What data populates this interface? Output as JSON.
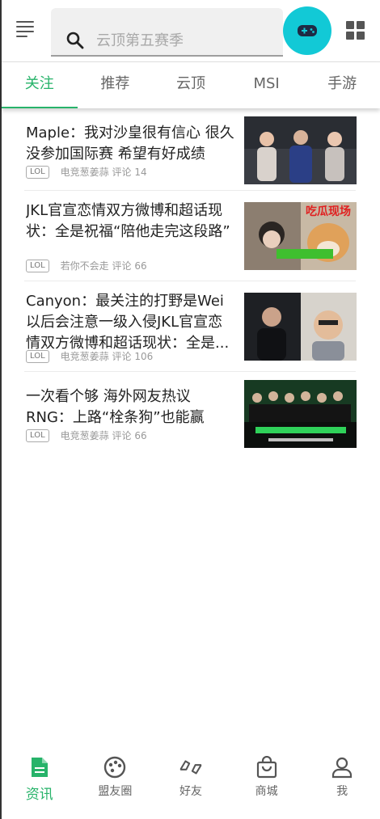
{
  "header": {
    "search_placeholder": "云顶第五赛季"
  },
  "tabs": [
    {
      "label": "关注",
      "active": true
    },
    {
      "label": "推荐"
    },
    {
      "label": "云顶"
    },
    {
      "label": "MSI"
    },
    {
      "label": "手游"
    }
  ],
  "news": [
    {
      "title": "Maple：我对沙皇很有信心 很久没参加国际赛 希望有好成绩",
      "tag": "LOL",
      "source": "电竞葱姜蒜",
      "comments": "评论 14"
    },
    {
      "title": "JKL官宣恋情双方微博和超话现状：全是祝福“陪他走完这段路”",
      "tag": "LOL",
      "source": "若你不会走",
      "comments": "评论 66",
      "thumb_text": "吃瓜现场"
    },
    {
      "title": "Canyon：最关注的打野是Wei 以后会注意一级入侵JKL官宣恋情双方微博和超话现状：全是...",
      "tag": "LOL",
      "source": "电竞葱姜蒜",
      "comments": "评论 106"
    },
    {
      "title": "一次看个够 海外网友热议RNG：上路“栓条狗”也能赢",
      "tag": "LOL",
      "source": "电竞葱姜蒜",
      "comments": "评论 66"
    }
  ],
  "bottom_nav": [
    {
      "label": "资讯",
      "icon": "document-icon",
      "active": true
    },
    {
      "label": "盟友圈",
      "icon": "palette-icon"
    },
    {
      "label": "好友",
      "icon": "handshake-icon"
    },
    {
      "label": "商城",
      "icon": "shopping-bag-icon"
    },
    {
      "label": "我",
      "icon": "person-icon"
    }
  ],
  "colors": {
    "accent": "#27b36a",
    "game_button": "#12c9d6"
  }
}
